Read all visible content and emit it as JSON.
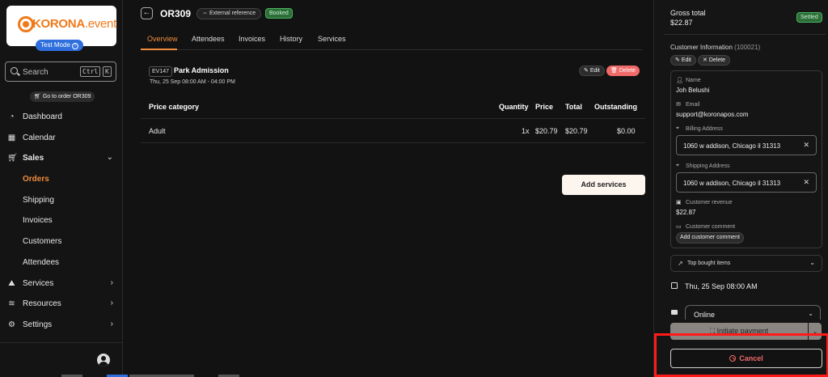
{
  "sidebar": {
    "logo_brand": "KORONA",
    "logo_suffix": ".event",
    "test_mode": "Test Mode",
    "search_placeholder": "Search",
    "search_kbd_1": "Ctrl",
    "search_kbd_2": "K",
    "goto_order": "Go to order OR309",
    "items": [
      {
        "label": "Dashboard",
        "icon": "dashboard-icon"
      },
      {
        "label": "Calendar",
        "icon": "calendar-icon"
      },
      {
        "label": "Sales",
        "icon": "cart-icon"
      },
      {
        "label": "Orders"
      },
      {
        "label": "Shipping"
      },
      {
        "label": "Invoices"
      },
      {
        "label": "Customers"
      },
      {
        "label": "Attendees"
      },
      {
        "label": "Services",
        "icon": "services-icon"
      },
      {
        "label": "Resources",
        "icon": "resources-icon"
      },
      {
        "label": "Settings",
        "icon": "gear-icon"
      }
    ]
  },
  "header": {
    "order_id": "OR309",
    "external_reference": "External reference",
    "status": "Booked"
  },
  "tabs": [
    "Overview",
    "Attendees",
    "Invoices",
    "History",
    "Services"
  ],
  "event": {
    "code": "EV147",
    "name": "Park Admission",
    "date": "Thu, 25 Sep 08:00 AM - 04:00 PM",
    "edit_label": "Edit",
    "delete_label": "Delete"
  },
  "table": {
    "headers": [
      "Price category",
      "Quantity",
      "Price",
      "Total",
      "Outstanding"
    ],
    "rows": [
      {
        "category": "Adult",
        "quantity": "1x",
        "price": "$20.79",
        "total": "$20.79",
        "outstanding": "$0.00"
      }
    ]
  },
  "add_services": "Add services",
  "summary": {
    "gross_label": "Gross total",
    "gross_value": "$22.87",
    "status": "Settled",
    "customer_info_title": "Customer Information",
    "customer_id": "(100021)",
    "edit_label": "Edit",
    "delete_label": "Delete",
    "name_label": "Name",
    "name_value": "Joh Belushi",
    "email_label": "Email",
    "email_value": "support@koronapos.com",
    "billing_label": "Billing Address",
    "billing_value": "1060 w addison, Chicago il  31313",
    "shipping_label": "Shipping Address",
    "shipping_value": "1060 w addison, Chicago il  31313",
    "revenue_label": "Customer revenue",
    "revenue_value": "$22.87",
    "comment_label": "Customer comment",
    "add_comment": "Add customer comment",
    "top_bought": "Top bought items",
    "date": "Thu, 25 Sep 08:00 AM",
    "payment_method": "Online",
    "initiate_payment": "Initiate payment",
    "cancel": "Cancel"
  }
}
